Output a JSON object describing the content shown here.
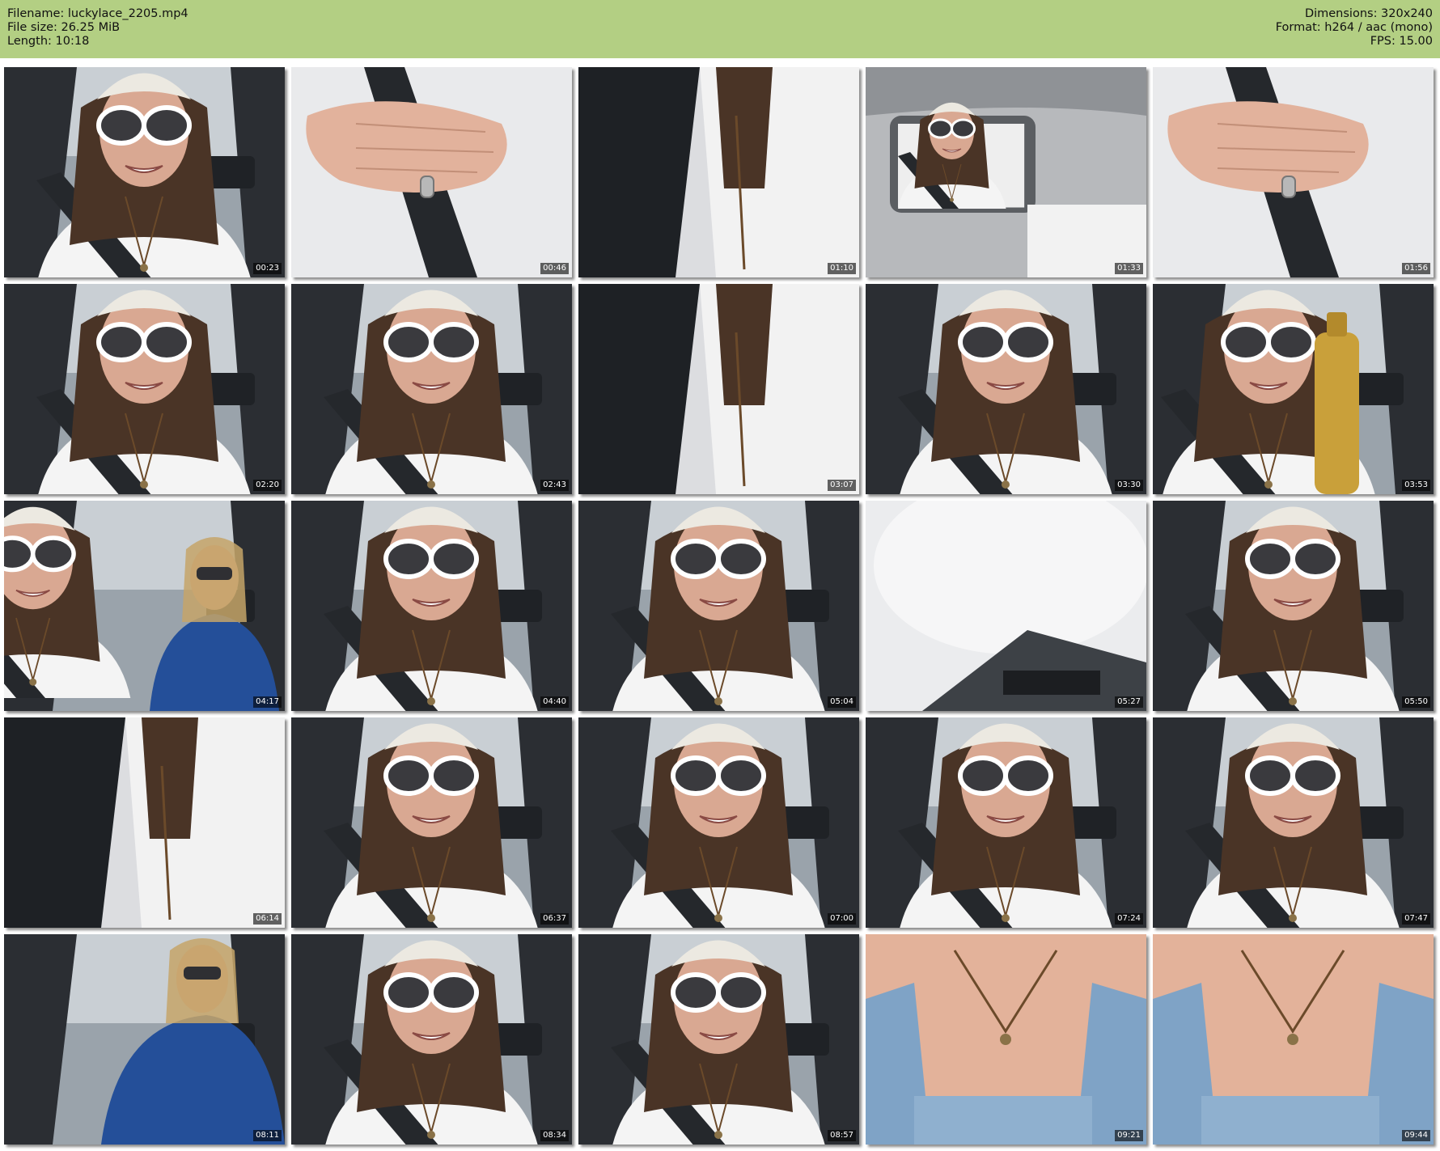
{
  "header": {
    "filename": "Filename: luckylace_2205.mp4",
    "filesize": "File size: 26.25 MiB",
    "length": "Length: 10:18",
    "dimensions": "Dimensions: 320x240",
    "format": "Format: h264 / aac (mono)",
    "fps": "FPS: 15.00",
    "background_color": "#b3cf83"
  },
  "thumbnails": [
    {
      "time": "00:23",
      "scene": "selfie"
    },
    {
      "time": "00:46",
      "scene": "hand"
    },
    {
      "time": "01:10",
      "scene": "closeup"
    },
    {
      "time": "01:33",
      "scene": "mirror"
    },
    {
      "time": "01:56",
      "scene": "hand"
    },
    {
      "time": "02:20",
      "scene": "selfie"
    },
    {
      "time": "02:43",
      "scene": "selfie"
    },
    {
      "time": "03:07",
      "scene": "closeup"
    },
    {
      "time": "03:30",
      "scene": "selfie"
    },
    {
      "time": "03:53",
      "scene": "bottle"
    },
    {
      "time": "04:17",
      "scene": "passenger"
    },
    {
      "time": "04:40",
      "scene": "selfie"
    },
    {
      "time": "05:04",
      "scene": "selfie"
    },
    {
      "time": "05:27",
      "scene": "blur"
    },
    {
      "time": "05:50",
      "scene": "selfie"
    },
    {
      "time": "06:14",
      "scene": "closeup"
    },
    {
      "time": "06:37",
      "scene": "selfie"
    },
    {
      "time": "07:00",
      "scene": "selfie"
    },
    {
      "time": "07:24",
      "scene": "selfie"
    },
    {
      "time": "07:47",
      "scene": "selfie"
    },
    {
      "time": "08:11",
      "scene": "driver"
    },
    {
      "time": "08:34",
      "scene": "selfie"
    },
    {
      "time": "08:57",
      "scene": "selfie"
    },
    {
      "time": "09:21",
      "scene": "overalls"
    },
    {
      "time": "09:44",
      "scene": "overalls"
    }
  ]
}
